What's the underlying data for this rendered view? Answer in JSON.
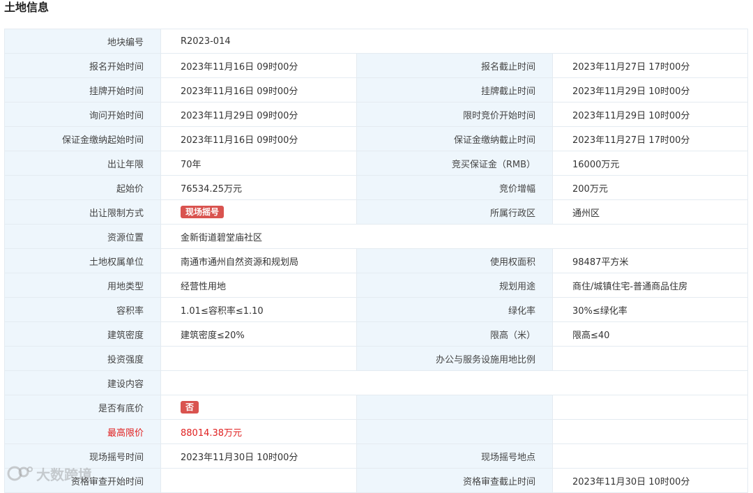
{
  "page_title": "土地信息",
  "watermark_text": "大数跨境",
  "colors": {
    "label_bg": "#eef6fc",
    "border": "#e4ebf1",
    "badge_bg": "#d9534f",
    "highlight_text": "#e02020"
  },
  "rows": [
    {
      "left_label": "地块编号",
      "left_value": "R2023-014",
      "full": true
    },
    {
      "left_label": "报名开始时间",
      "left_value": "2023年11月16日 09时00分",
      "right_label": "报名截止时间",
      "right_value": "2023年11月27日 17时00分"
    },
    {
      "left_label": "挂牌开始时间",
      "left_value": "2023年11月16日 09时00分",
      "right_label": "挂牌截止时间",
      "right_value": "2023年11月29日 10时00分"
    },
    {
      "left_label": "询问开始时间",
      "left_value": "2023年11月29日 09时00分",
      "right_label": "限时竞价开始时间",
      "right_value": "2023年11月29日 10时00分"
    },
    {
      "left_label": "保证金缴纳起始时间",
      "left_value": "2023年11月16日 09时00分",
      "right_label": "保证金缴纳截止时间",
      "right_value": "2023年11月27日 17时00分"
    },
    {
      "left_label": "出让年限",
      "left_value": "70年",
      "right_label": "竞买保证金（RMB）",
      "right_value": "16000万元"
    },
    {
      "left_label": "起始价",
      "left_value": "76534.25万元",
      "right_label": "竞价增幅",
      "right_value": "200万元"
    },
    {
      "left_label": "出让限制方式",
      "left_value": "现场摇号",
      "left_badge": true,
      "right_label": "所属行政区",
      "right_value": "通州区"
    },
    {
      "left_label": "资源位置",
      "left_value": "金新街道碧堂庙社区",
      "full": true
    },
    {
      "left_label": "土地权属单位",
      "left_value": "南通市通州自然资源和规划局",
      "right_label": "使用权面积",
      "right_value": "98487平方米"
    },
    {
      "left_label": "用地类型",
      "left_value": "经营性用地",
      "right_label": "规划用途",
      "right_value": "商住/城镇住宅-普通商品住房"
    },
    {
      "left_label": "容积率",
      "left_value": "1.01≤容积率≤1.10",
      "right_label": "绿化率",
      "right_value": "30%≤绿化率"
    },
    {
      "left_label": "建筑密度",
      "left_value": "建筑密度≤20%",
      "right_label": "限高（米）",
      "right_value": "限高≤40"
    },
    {
      "left_label": "投资强度",
      "left_value": "",
      "right_label": "办公与服务设施用地比例",
      "right_value": ""
    },
    {
      "left_label": "建设内容",
      "left_value": "",
      "full": true
    },
    {
      "left_label": "是否有底价",
      "left_value": "否",
      "left_badge": true,
      "right_label": "",
      "right_value": ""
    },
    {
      "left_label": "最高限价",
      "left_value": "88014.38万元",
      "highlight": true,
      "right_label": "",
      "right_value": ""
    },
    {
      "left_label": "现场摇号时间",
      "left_value": "2023年11月30日 10时00分",
      "right_label": "现场摇号地点",
      "right_value": ""
    },
    {
      "left_label": "资格审查开始时间",
      "left_value": "",
      "right_label": "资格审查截止时间",
      "right_value": "2023年11月30日 10时00分"
    }
  ]
}
